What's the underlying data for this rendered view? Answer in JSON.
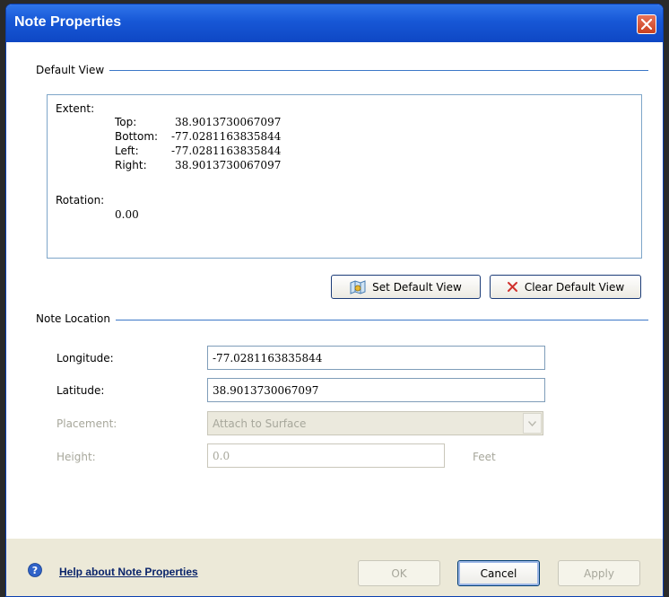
{
  "window": {
    "title": "Note Properties"
  },
  "default_view": {
    "section_title": "Default View",
    "extent_label": "Extent:",
    "top_label": "Top:",
    "top_value": "38.9013730067097",
    "bottom_label": "Bottom:",
    "bottom_value": "-77.0281163835844",
    "left_label": "Left:",
    "left_value": "-77.0281163835844",
    "right_label": "Right:",
    "right_value": "38.9013730067097",
    "rotation_label": "Rotation:",
    "rotation_value": "0.00",
    "set_button": "Set Default View",
    "clear_button": "Clear Default View"
  },
  "note_location": {
    "section_title": "Note Location",
    "longitude_label": "Longitude:",
    "longitude_value": "-77.0281163835844",
    "latitude_label": "Latitude:",
    "latitude_value": "38.9013730067097",
    "placement_label": "Placement:",
    "placement_value": "Attach to Surface",
    "height_label": "Height:",
    "height_value": "0.0",
    "height_unit": "Feet"
  },
  "footer": {
    "help_link": "Help about Note Properties",
    "ok_label": "OK",
    "cancel_label": "Cancel",
    "apply_label": "Apply"
  },
  "colors": {
    "title_bar": "#1757d6",
    "section_line": "#3c78c8",
    "footer_bg": "#ece9d8"
  },
  "icons": {
    "close": "close-icon",
    "set_view": "map-view-icon",
    "clear_view": "x-icon",
    "help": "help-icon"
  }
}
